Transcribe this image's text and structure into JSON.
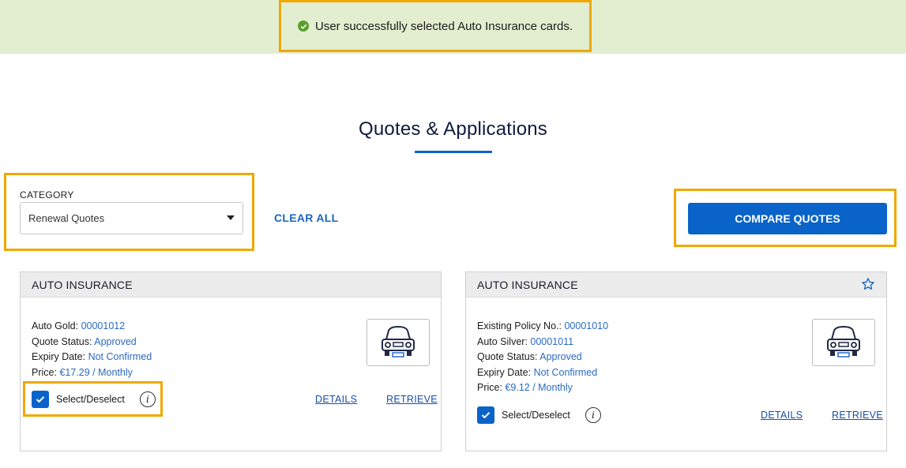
{
  "banner": {
    "message": "User successfully selected Auto Insurance cards."
  },
  "page": {
    "title": "Quotes & Applications"
  },
  "filters": {
    "category_label": "CATEGORY",
    "category_selected": "Renewal Quotes",
    "clear_all_label": "CLEAR ALL"
  },
  "actions": {
    "compare_label": "COMPARE QUOTES"
  },
  "cards": [
    {
      "title": "AUTO INSURANCE",
      "lines": [
        {
          "label": "Auto Gold:",
          "value": "00001012"
        },
        {
          "label": "Quote Status:",
          "value": "Approved"
        },
        {
          "label": "Expiry Date:",
          "value": "Not Confirmed"
        },
        {
          "label": "Price:",
          "value": "€17.29 / Monthly"
        }
      ],
      "select_label": "Select/Deselect",
      "selected": true,
      "details_label": "DETAILS",
      "retrieve_label": "RETRIEVE"
    },
    {
      "title": "AUTO INSURANCE",
      "lines": [
        {
          "label": "Existing Policy No.:",
          "value": "00001010"
        },
        {
          "label": "Auto Silver:",
          "value": "00001011"
        },
        {
          "label": "Quote Status:",
          "value": "Approved"
        },
        {
          "label": "Expiry Date:",
          "value": "Not Confirmed"
        },
        {
          "label": "Price:",
          "value": "€9.12 / Monthly"
        }
      ],
      "select_label": "Select/Deselect",
      "selected": true,
      "details_label": "DETAILS",
      "retrieve_label": "RETRIEVE",
      "favorite_icon": "star-outline-icon"
    }
  ],
  "colors": {
    "accent": "#0a63c9",
    "highlight": "#f0a800",
    "banner_bg": "#e2eecf",
    "success": "#5aa02c",
    "value_text": "#2a6ac2"
  }
}
